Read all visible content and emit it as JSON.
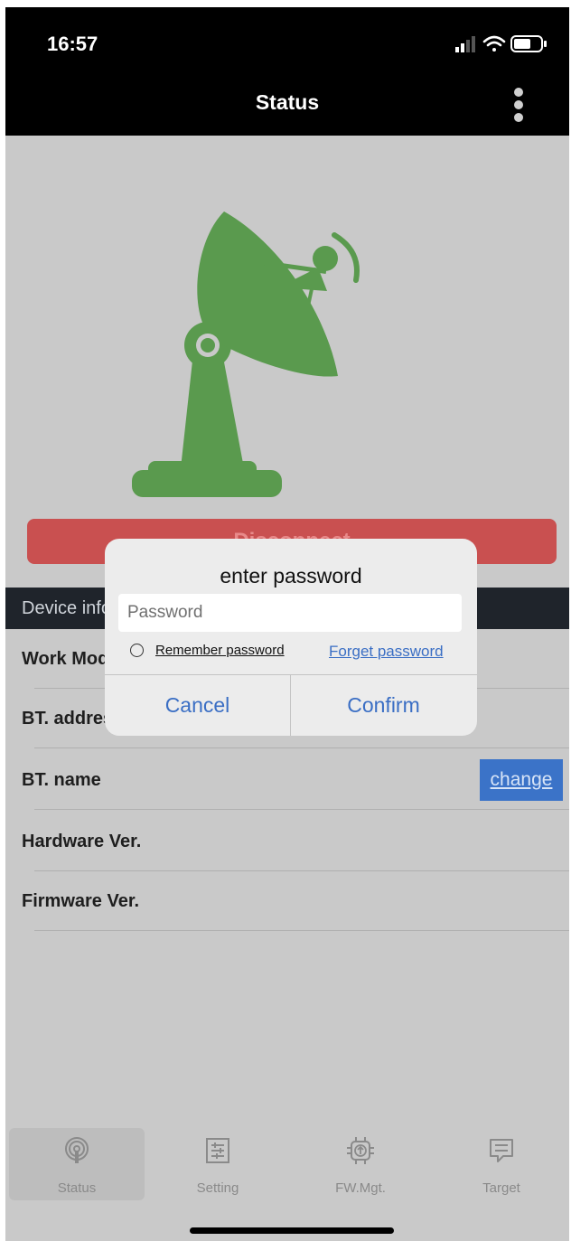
{
  "statusbar": {
    "time": "16:57"
  },
  "nav": {
    "title": "Status",
    "menu_icon": "more-vertical-icon"
  },
  "hero": {
    "icon": "satellite-dish-icon",
    "color": "#5a9a4e"
  },
  "disconnect_label": "Disconnect",
  "device_info": {
    "header": "Device information",
    "rows": [
      {
        "label": "Work Mode"
      },
      {
        "label": "BT. address"
      },
      {
        "label": "BT. name",
        "action": "change"
      },
      {
        "label": "Hardware Ver."
      },
      {
        "label": "Firmware Ver."
      }
    ]
  },
  "dialog": {
    "title": "enter password",
    "password_placeholder": "Password",
    "remember_label": "Remember password",
    "forget_label": "Forget password",
    "cancel_label": "Cancel",
    "confirm_label": "Confirm"
  },
  "tabs": [
    {
      "label": "Status",
      "icon": "broadcast-icon",
      "active": true
    },
    {
      "label": "Setting",
      "icon": "settings-sliders-icon",
      "active": false
    },
    {
      "label": "FW.Mgt.",
      "icon": "chip-upload-icon",
      "active": false
    },
    {
      "label": "Target",
      "icon": "message-icon",
      "active": false
    }
  ],
  "colors": {
    "accent": "#3a6ec4",
    "danger": "#c95050",
    "change_bg": "#3b73c8"
  }
}
